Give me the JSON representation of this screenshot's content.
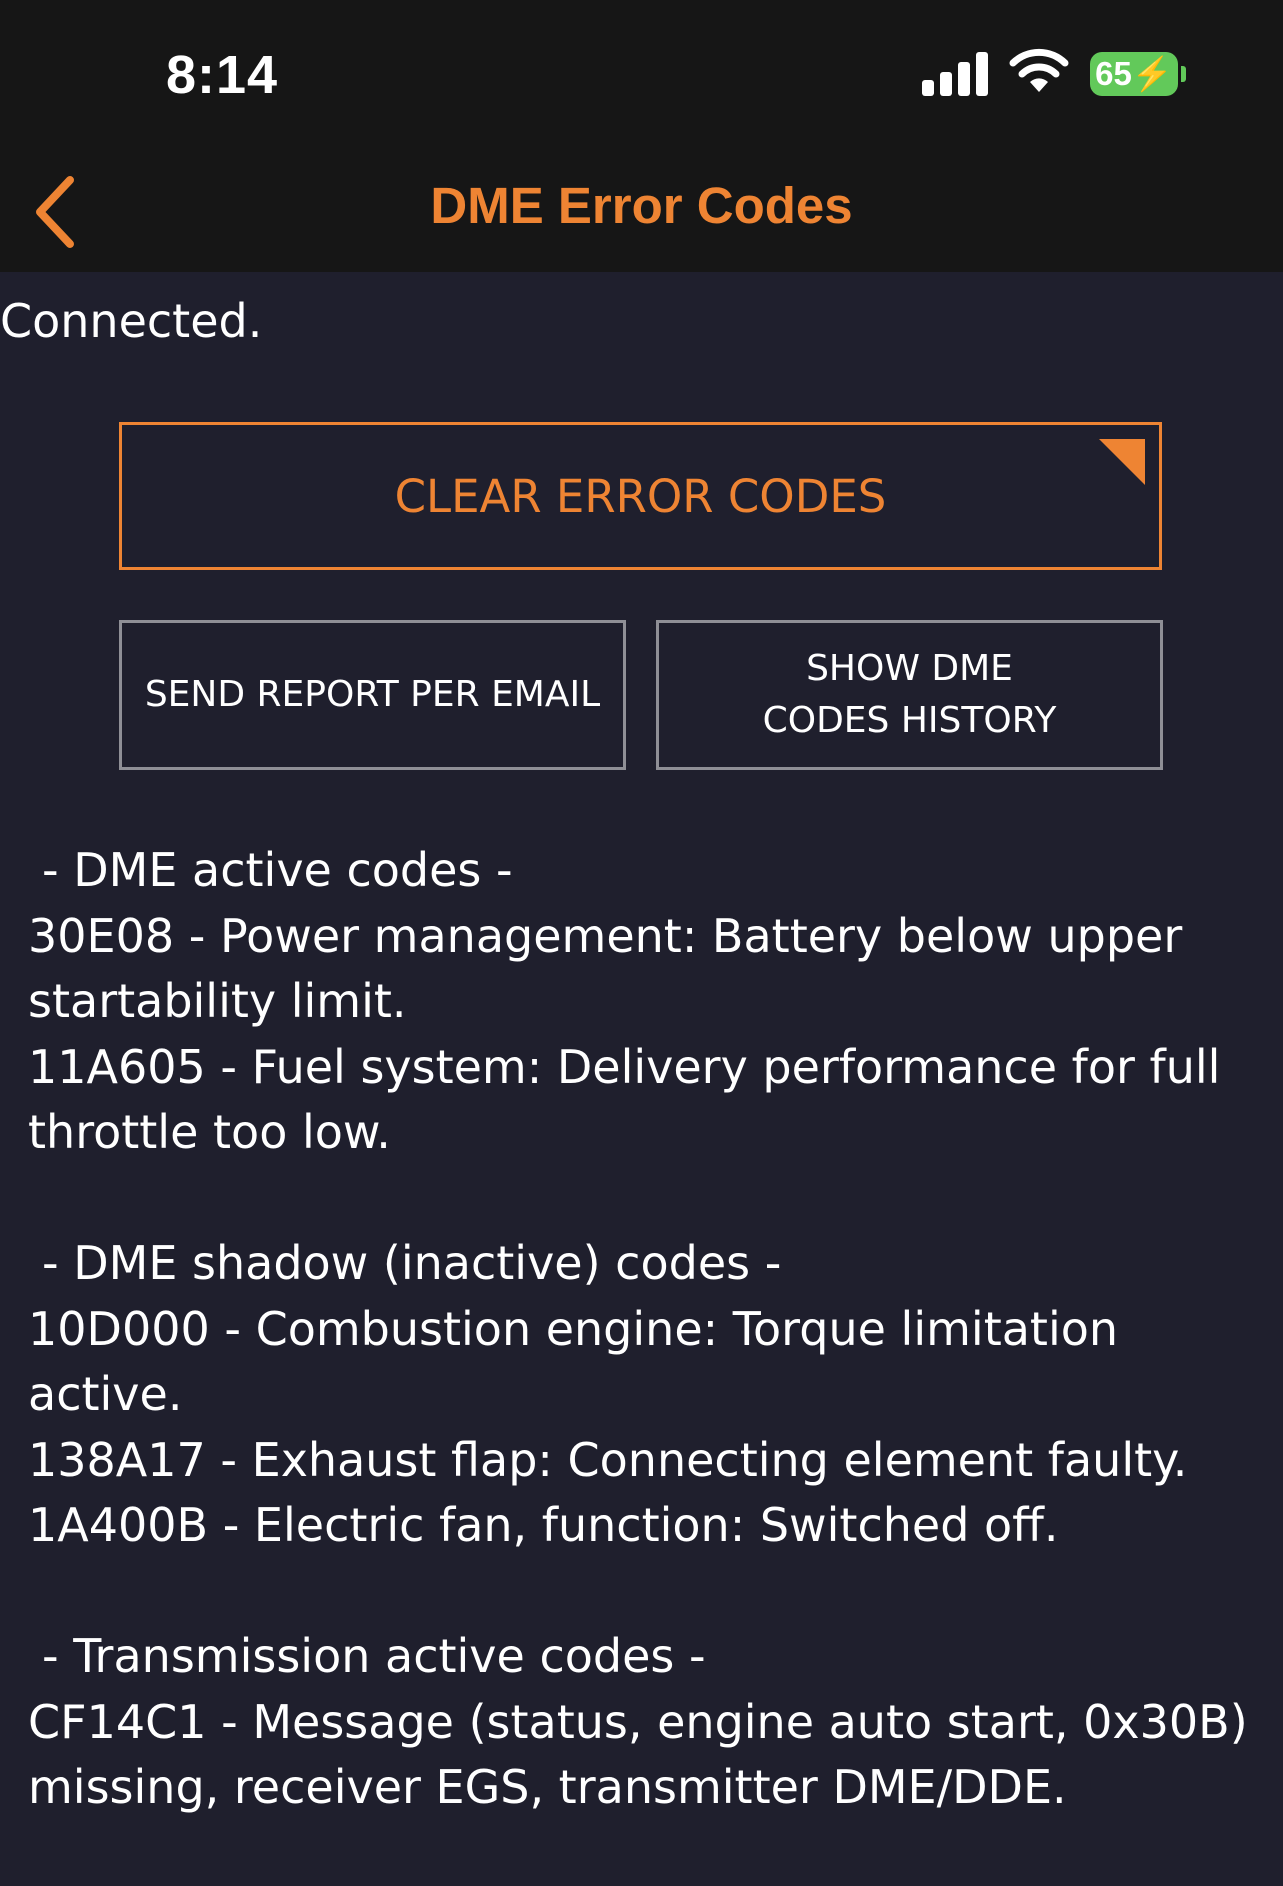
{
  "status_bar": {
    "time": "8:14",
    "battery_level": "65",
    "charging": true,
    "icons": [
      "cellular-signal-icon",
      "wifi-icon",
      "battery-icon"
    ]
  },
  "nav": {
    "title": "DME Error Codes",
    "back_icon": "chevron-left-icon"
  },
  "connection_status": "Connected.",
  "buttons": {
    "clear": "CLEAR ERROR CODES",
    "send_report": "SEND REPORT PER EMAIL",
    "history_line1": "SHOW DME",
    "history_line2": "CODES HISTORY"
  },
  "sections": [
    {
      "heading": "- DME active codes -",
      "lines": [
        "30E08 - Power management: Battery below upper startability limit.",
        "11A605 - Fuel system: Delivery performance for full throttle too low."
      ]
    },
    {
      "heading": "- DME shadow (inactive) codes -",
      "lines": [
        "10D000 - Combustion engine: Torque limitation active.",
        "138A17 - Exhaust flap: Connecting element faulty.",
        "1A400B - Electric fan, function: Switched off."
      ]
    },
    {
      "heading": "- Transmission active codes -",
      "lines": [
        "CF14C1 - Message (status, engine auto start, 0x30B) missing, receiver EGS, transmitter DME/DDE."
      ]
    }
  ],
  "colors": {
    "accent": "#ee8433",
    "background": "#1f1f2d",
    "bar_background": "#161616",
    "battery": "#62c95a"
  }
}
